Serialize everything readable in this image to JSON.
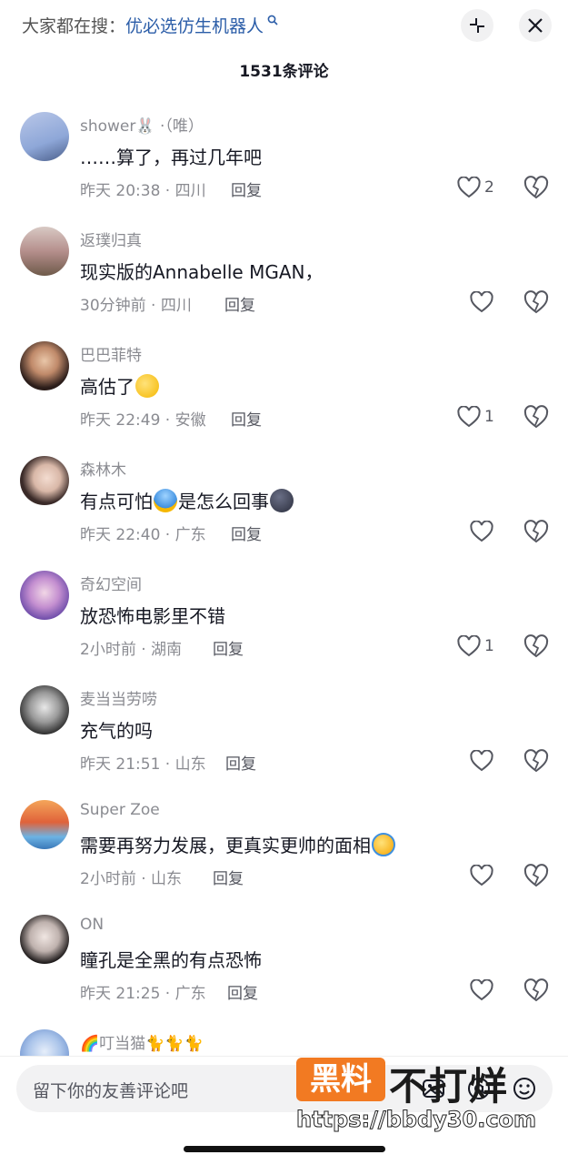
{
  "header": {
    "search_prefix": "大家都在搜：",
    "search_keyword": "优必选仿生机器人",
    "search_icon": "search-icon",
    "collapse_icon": "collapse-icon",
    "close_icon": "close-icon",
    "comment_count": "1531条评论"
  },
  "comments": [
    {
      "user": "shower🐰 ·（唯）",
      "text": "……算了，再过几年吧",
      "time_loc": "昨天 20:38 · 四川",
      "reply": "回复",
      "likes": "2"
    },
    {
      "user": "返璞归真",
      "text": "现实版的Annabelle   MGAN，",
      "time_loc": "30分钟前 · 四川",
      "reply": "回复",
      "likes": ""
    },
    {
      "user": "巴巴菲特",
      "text": "高估了",
      "time_loc": "昨天 22:49 · 安徽",
      "reply": "回复",
      "likes": "1"
    },
    {
      "user": "森林木",
      "text_a": "有点可怕",
      "text_b": "是怎么回事",
      "time_loc": "昨天 22:40 · 广东",
      "reply": "回复",
      "likes": ""
    },
    {
      "user": "奇幻空间",
      "text": "放恐怖电影里不错",
      "time_loc": "2小时前 · 湖南",
      "reply": "回复",
      "likes": "1"
    },
    {
      "user": "麦当当劳唠",
      "text": "充气的吗",
      "time_loc": "昨天 21:51 · 山东",
      "reply": "回复",
      "likes": ""
    },
    {
      "user": "Super Zoe",
      "text": "需要再努力发展，更真实更帅的面相",
      "time_loc": "2小时前 · 山东",
      "reply": "回复",
      "likes": ""
    },
    {
      "user": "ON",
      "text": "瞳孔是全黑的有点恐怖",
      "time_loc": "昨天 21:25 · 广东",
      "reply": "回复",
      "likes": ""
    },
    {
      "user": "🌈叮当猫🐈🐈🐈"
    }
  ],
  "input": {
    "placeholder": "留下你的友善评论吧"
  },
  "watermark": {
    "box": "黑料",
    "text": "不打烊",
    "url": "https://bbdy30.com"
  },
  "colors": {
    "accent_link": "#2b5da8",
    "text_primary": "#161823",
    "text_secondary": "#8a8b91",
    "watermark_orange": "#f27a22"
  }
}
